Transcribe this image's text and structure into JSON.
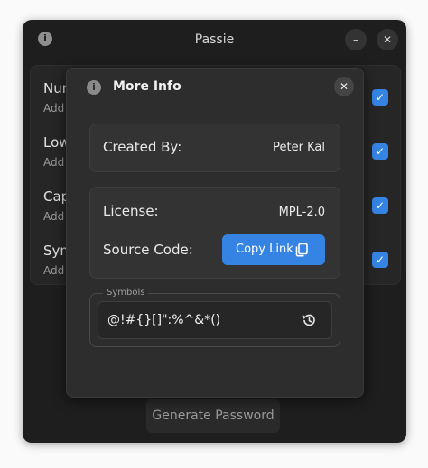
{
  "window": {
    "title": "Passie"
  },
  "background": {
    "rows": [
      {
        "title": "Num",
        "sub": "Add"
      },
      {
        "title": "Low",
        "sub": "Add"
      },
      {
        "title": "Cap",
        "sub": "Add"
      },
      {
        "title": "Sym",
        "sub": "Add"
      }
    ],
    "generate_label": "Generate Password"
  },
  "dialog": {
    "title": "More Info",
    "created_by_label": "Created By:",
    "created_by_value": "Peter Kal",
    "license_label": "License:",
    "license_value": "MPL-2.0",
    "source_label": "Source Code:",
    "copy_link_label": "Copy Link",
    "symbols_label": "Symbols",
    "symbols_value": "@!#{}[]\":%^&*()"
  },
  "icons": {
    "info": "info-icon",
    "minimize": "minimize-icon",
    "close": "close-icon",
    "check": "check-icon",
    "copy": "copy-icon",
    "reset": "history-icon"
  },
  "colors": {
    "accent": "#3584e4",
    "window_bg": "#1e1e1e",
    "dialog_bg": "#2d2d2d",
    "card_bg": "#333333"
  }
}
